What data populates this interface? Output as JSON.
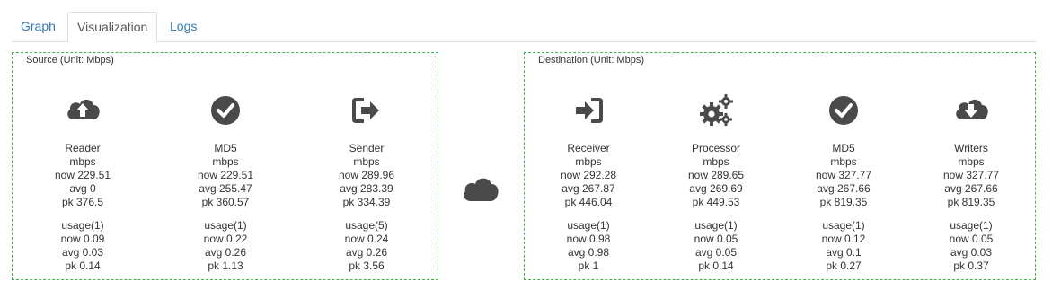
{
  "tabs": [
    {
      "label": "Graph",
      "active": false
    },
    {
      "label": "Visualization",
      "active": true
    },
    {
      "label": "Logs",
      "active": false
    }
  ],
  "source": {
    "title": "Source (Unit: Mbps)",
    "columns": [
      {
        "icon": "cloud-upload-icon",
        "name": "Reader",
        "unit": "mbps",
        "now": "now  229.51",
        "avg": "avg  0",
        "pk": "pk  376.5",
        "usage": "usage(1)",
        "unow": "now  0.09",
        "uavg": "avg  0.03",
        "upk": "pk  0.14"
      },
      {
        "icon": "check-circle-icon",
        "name": "MD5",
        "unit": "mbps",
        "now": "now  229.51",
        "avg": "avg  255.47",
        "pk": "pk  360.57",
        "usage": "usage(1)",
        "unow": "now  0.22",
        "uavg": "avg  0.26",
        "upk": "pk  1.13"
      },
      {
        "icon": "sign-out-icon",
        "name": "Sender",
        "unit": "mbps",
        "now": "now  289.96",
        "avg": "avg  283.39",
        "pk": "pk  334.39",
        "usage": "usage(5)",
        "unow": "now  0.24",
        "uavg": "avg  0.26",
        "upk": "pk  3.56"
      }
    ]
  },
  "destination": {
    "title": "Destination (Unit: Mbps)",
    "columns": [
      {
        "icon": "sign-in-icon",
        "name": "Receiver",
        "unit": "mbps",
        "now": "now  292.28",
        "avg": "avg  267.87",
        "pk": "pk  446.04",
        "usage": "usage(1)",
        "unow": "now  0.98",
        "uavg": "avg  0.98",
        "upk": "pk  1"
      },
      {
        "icon": "gears-icon",
        "name": "Processor",
        "unit": "mbps",
        "now": "now  289.65",
        "avg": "avg  269.69",
        "pk": "pk  449.53",
        "usage": "usage(1)",
        "unow": "now  0.05",
        "uavg": "avg  0.05",
        "upk": "pk  0.14"
      },
      {
        "icon": "check-circle-icon",
        "name": "MD5",
        "unit": "mbps",
        "now": "now  327.77",
        "avg": "avg  267.66",
        "pk": "pk  819.35",
        "usage": "usage(1)",
        "unow": "now  0.12",
        "uavg": "avg  0.1",
        "upk": "pk  0.27"
      },
      {
        "icon": "cloud-download-icon",
        "name": "Writers",
        "unit": "mbps",
        "now": "now  327.77",
        "avg": "avg  267.66",
        "pk": "pk  819.35",
        "usage": "usage(1)",
        "unow": "now  0.05",
        "uavg": "avg  0.03",
        "upk": "pk  0.37"
      }
    ]
  },
  "connector_icon": "cloud-icon",
  "colors": {
    "icon": "#4a4a4a",
    "border": "#4caf50",
    "link": "#337ab7"
  }
}
